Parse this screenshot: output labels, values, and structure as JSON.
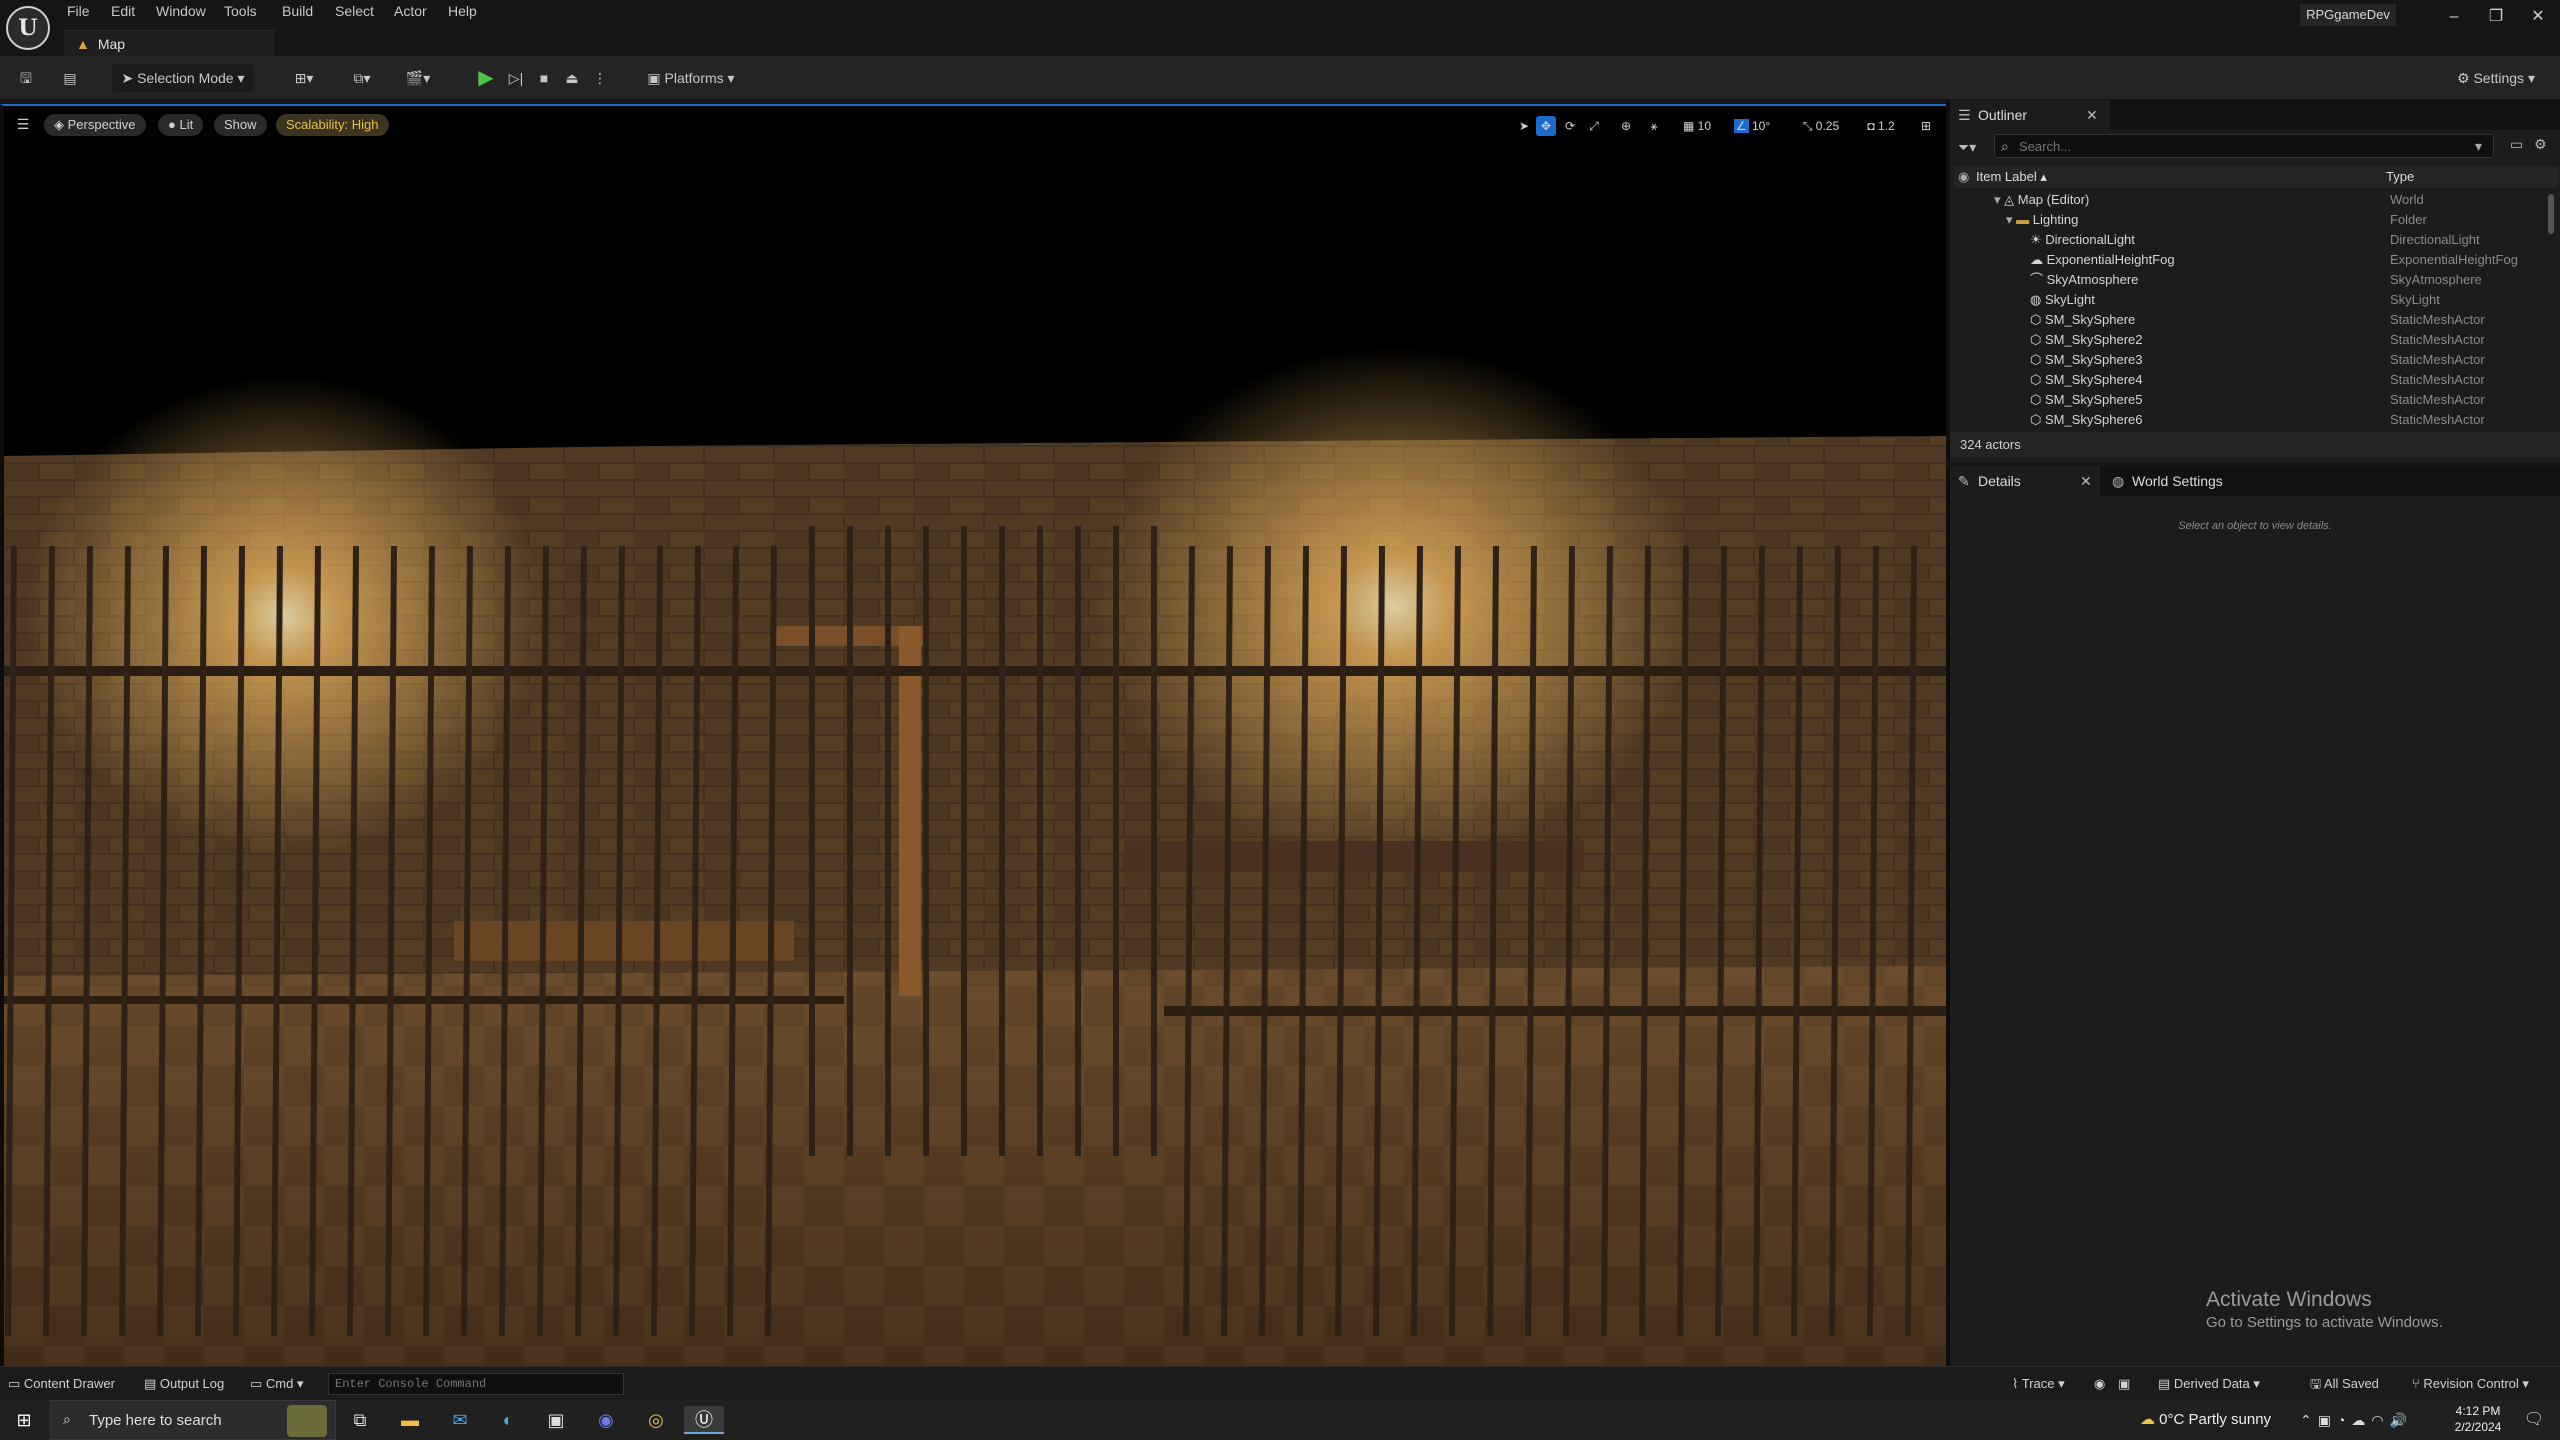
{
  "app": {
    "project_name": "RPGgameDev",
    "logo_glyph": "U"
  },
  "menu": [
    "File",
    "Edit",
    "Window",
    "Tools",
    "Build",
    "Select",
    "Actor",
    "Help"
  ],
  "window_controls": {
    "minimize": "–",
    "maximize": "❐",
    "close": "✕"
  },
  "level_tab": {
    "label": "Map"
  },
  "toolbar": {
    "selection_mode": "Selection Mode",
    "platforms": "Platforms",
    "settings": "Settings"
  },
  "viewport": {
    "perspective": "Perspective",
    "lit": "Lit",
    "show": "Show",
    "scalability": "Scalability: High",
    "grid_snap": "10",
    "rotation_snap": "10°",
    "scale_snap": "0.25",
    "camera_speed": "1.2"
  },
  "outliner": {
    "tab_label": "Outliner",
    "search_placeholder": "Search...",
    "col_label": "Item Label ▴",
    "col_type": "Type",
    "rows": [
      {
        "label": "Map (Editor)",
        "type": "World"
      },
      {
        "label": "Lighting",
        "type": "Folder"
      },
      {
        "label": "DirectionalLight",
        "type": "DirectionalLight"
      },
      {
        "label": "ExponentialHeightFog",
        "type": "ExponentialHeightFog"
      },
      {
        "label": "SkyAtmosphere",
        "type": "SkyAtmosphere"
      },
      {
        "label": "SkyLight",
        "type": "SkyLight"
      },
      {
        "label": "SM_SkySphere",
        "type": "StaticMeshActor"
      },
      {
        "label": "SM_SkySphere2",
        "type": "StaticMeshActor"
      },
      {
        "label": "SM_SkySphere3",
        "type": "StaticMeshActor"
      },
      {
        "label": "SM_SkySphere4",
        "type": "StaticMeshActor"
      },
      {
        "label": "SM_SkySphere5",
        "type": "StaticMeshActor"
      },
      {
        "label": "SM_SkySphere6",
        "type": "StaticMeshActor"
      }
    ],
    "actor_count": "324 actors"
  },
  "details": {
    "tab_details": "Details",
    "tab_world_settings": "World Settings",
    "empty_message": "Select an object to view details."
  },
  "watermark": {
    "title": "Activate Windows",
    "subtitle": "Go to Settings to activate Windows."
  },
  "statusbar": {
    "content_drawer": "Content Drawer",
    "output_log": "Output Log",
    "cmd": "Cmd",
    "console_placeholder": "Enter Console Command",
    "trace": "Trace",
    "derived_data": "Derived Data",
    "all_saved": "All Saved",
    "revision_control": "Revision Control"
  },
  "taskbar": {
    "search_placeholder": "Type here to search",
    "weather": "0°C  Partly sunny",
    "time": "4:12 PM",
    "date": "2/2/2024"
  },
  "colors": {
    "accent": "#1a6ccf",
    "play_green": "#4fc24a",
    "scalability": "#e6c24a",
    "folder": "#c9a34a"
  }
}
